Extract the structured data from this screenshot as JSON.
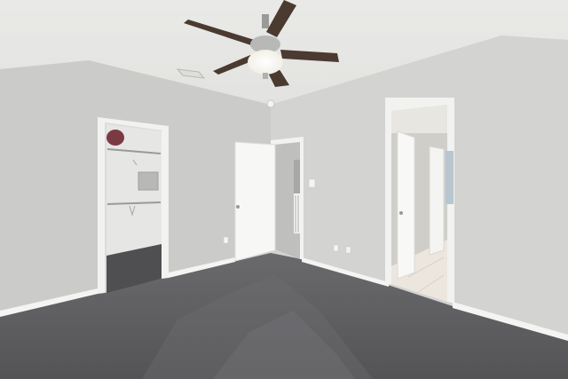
{
  "scene": {
    "colors": {
      "ceiling": "#e8e8e6",
      "wall_left": "#cdcdcb",
      "wall_right": "#d4d4d2",
      "carpet": "#5b5b5e",
      "trim": "#f4f4f2",
      "door": "#f6f6f4",
      "fan_blade": "#4a3a30",
      "closet_interior": "#e4e4e2",
      "tile_floor": "#ece6de"
    },
    "objects": [
      {
        "name": "ceiling-fan-icon",
        "role": "ceiling fan with light kit"
      },
      {
        "name": "hvac-vent-icon",
        "role": "ceiling air vent"
      },
      {
        "name": "walk-in-closet",
        "role": "open closet with shelves and hanging rods"
      },
      {
        "name": "bedroom-door",
        "role": "open white panel door"
      },
      {
        "name": "bathroom-doorway",
        "role": "open door to tiled hallway"
      },
      {
        "name": "light-switch-icon",
        "role": "wall switch plate"
      },
      {
        "name": "outlet-icon",
        "role": "wall outlets"
      }
    ]
  }
}
